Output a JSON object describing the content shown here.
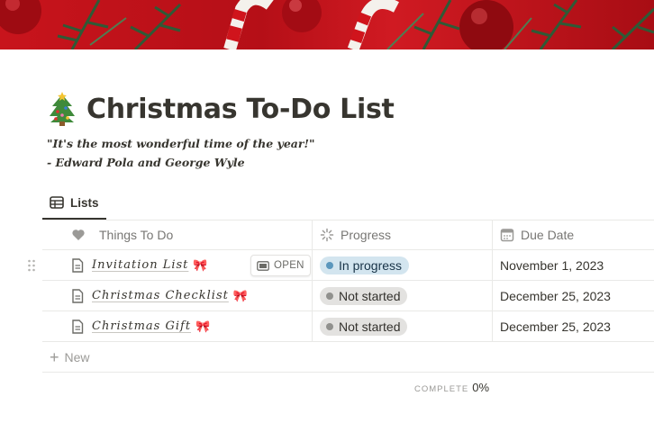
{
  "page": {
    "title": "Christmas To-Do List",
    "icon": "christmas-tree-icon",
    "quote_line1": "\"It's the most wonderful time of the year!\"",
    "quote_line2": "- Edward Pola and George Wyle"
  },
  "view_tab": {
    "label": "Lists",
    "icon": "table-icon"
  },
  "table": {
    "columns": [
      {
        "label": "Things To Do",
        "icon": "heart-icon"
      },
      {
        "label": "Progress",
        "icon": "loading-icon"
      },
      {
        "label": "Due Date",
        "icon": "calendar-icon"
      }
    ],
    "rows": [
      {
        "name": "Invitation List",
        "emoji": "🎀",
        "status": "In progress",
        "due": "November 1, 2023"
      },
      {
        "name": "Christmas Checklist",
        "emoji": "🎀",
        "status": "Not started",
        "due": "December 25, 2023"
      },
      {
        "name": "Christmas Gift",
        "emoji": "🎀",
        "status": "Not started",
        "due": "December 25, 2023"
      }
    ],
    "open_label": "OPEN",
    "new_label": "New"
  },
  "calculation": {
    "label": "COMPLETE",
    "value": "0%"
  },
  "colors": {
    "in_progress_bg": "#d3e5ef",
    "in_progress_dot": "#5b97bd",
    "not_started_bg": "#e3e2e0",
    "not_started_dot": "#91918e",
    "cover_red": "#c8141c"
  }
}
